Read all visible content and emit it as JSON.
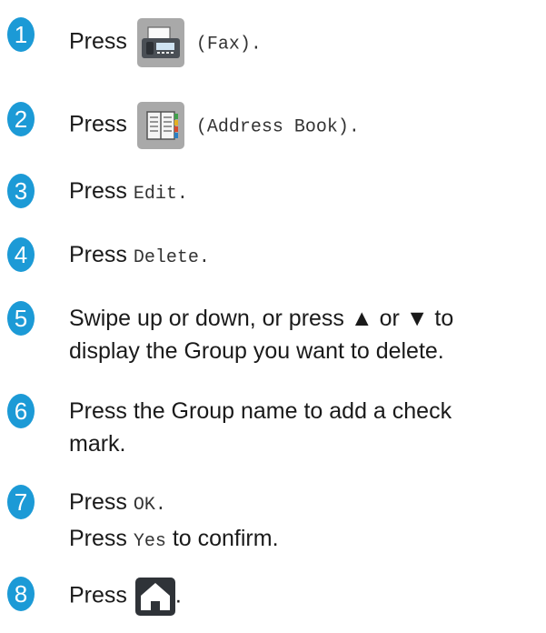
{
  "steps": [
    {
      "number": "1",
      "verb": "Press",
      "icon": "fax-icon",
      "param": "(Fax).",
      "param_pre": "(",
      "param_mono": "Fax",
      "param_post": ")."
    },
    {
      "number": "2",
      "verb": "Press",
      "icon": "address-book-icon",
      "param_pre": "(",
      "param_mono": "Address Book",
      "param_post": ")."
    },
    {
      "number": "3",
      "verb": "Press",
      "param_mono": "Edit",
      "param_post": "."
    },
    {
      "number": "4",
      "verb": "Press",
      "param_mono": "Delete",
      "param_post": "."
    },
    {
      "number": "5",
      "line1": "Swipe up or down, or press ▲ or ▼ to",
      "line2": "display the Group you want to delete."
    },
    {
      "number": "6",
      "line1": "Press the Group name to add a check",
      "line2": "mark."
    },
    {
      "number": "7",
      "verb": "Press",
      "param_mono": "OK",
      "param_post": ".",
      "verb2": "Press",
      "param2_mono": "Yes",
      "param2_post": " to confirm."
    },
    {
      "number": "8",
      "verb": "Press",
      "icon": "home-icon",
      "param_post": "."
    }
  ]
}
